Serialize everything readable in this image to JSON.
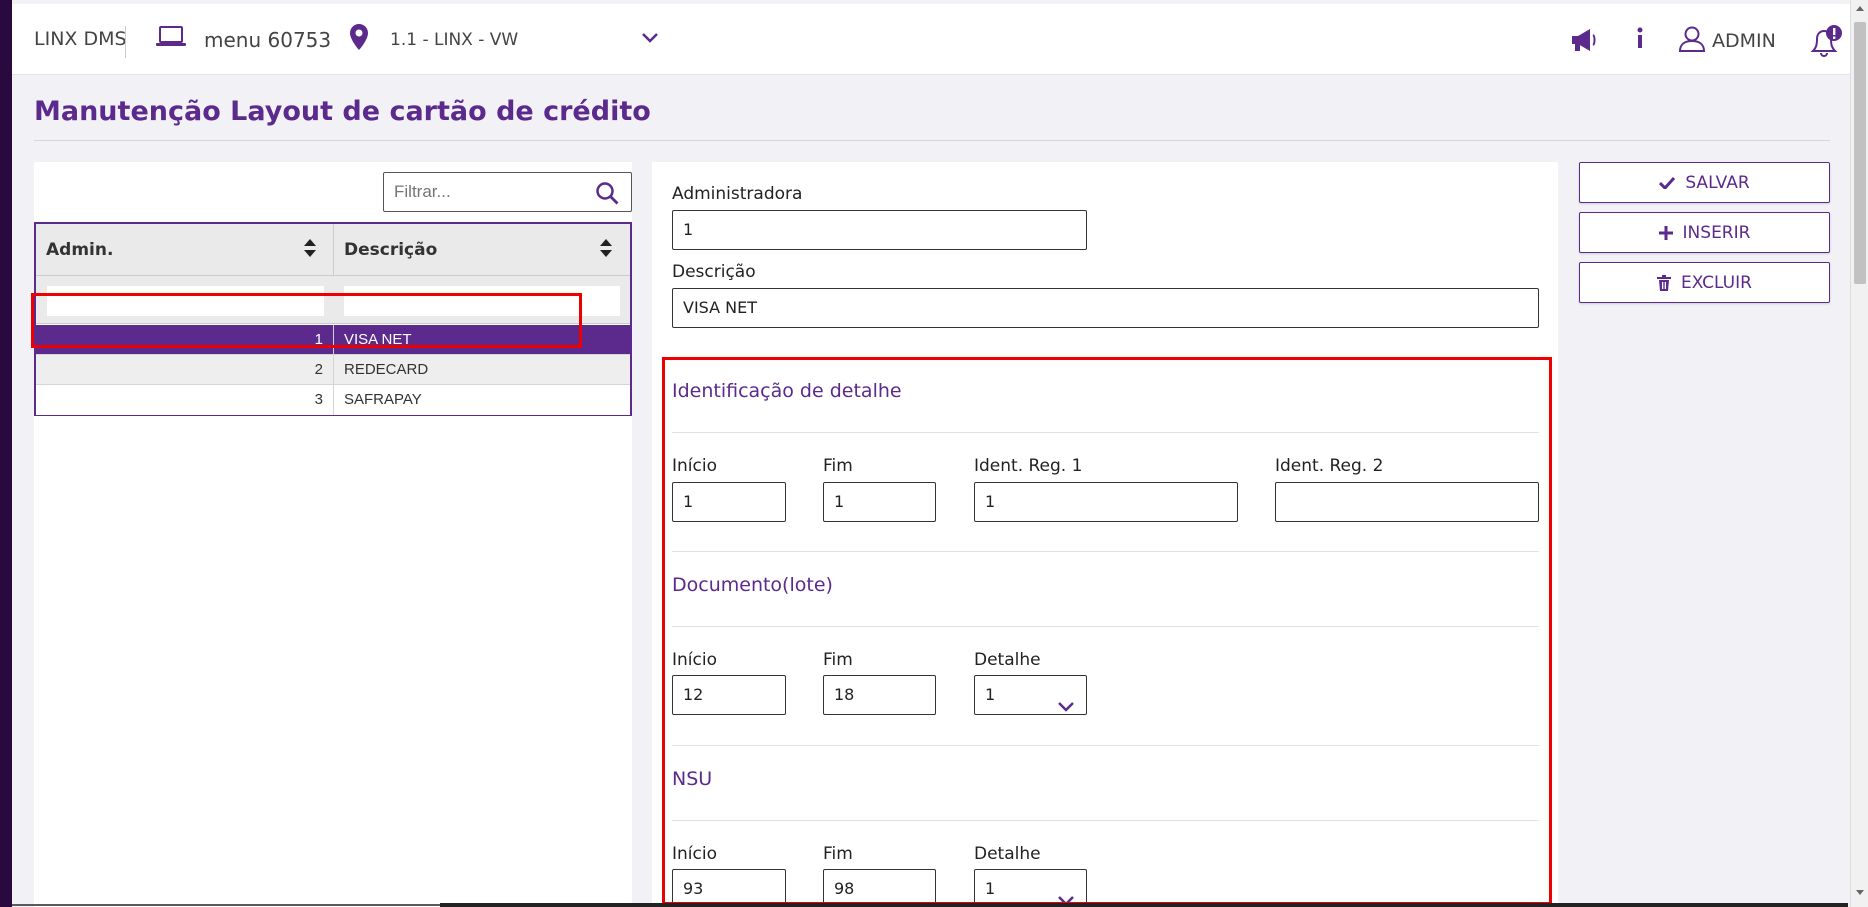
{
  "topbar": {
    "brand": "LINX DMS",
    "menu_label": "menu 60753",
    "location": "1.1 - LINX - VW",
    "user": "ADMIN",
    "icons": {
      "menu": "laptop-icon",
      "location": "map-pin-icon",
      "announce": "megaphone-icon",
      "info": "info-icon",
      "user": "user-icon",
      "notify": "bell-icon"
    }
  },
  "page": {
    "title": "Manutenção Layout de cartão de crédito"
  },
  "filter": {
    "placeholder": "Filtrar..."
  },
  "grid": {
    "columns": [
      "Admin.",
      "Descrição"
    ],
    "rows": [
      {
        "admin": "1",
        "descricao": "VISA NET",
        "selected": true
      },
      {
        "admin": "2",
        "descricao": "REDECARD",
        "selected": false
      },
      {
        "admin": "3",
        "descricao": "SAFRAPAY",
        "selected": false
      }
    ]
  },
  "form": {
    "administradora_label": "Administradora",
    "administradora_value": "1",
    "descricao_label": "Descrição",
    "descricao_value": "VISA NET",
    "sections": {
      "detalhe": {
        "title": "Identificação de detalhe",
        "inicio_label": "Início",
        "inicio_value": "1",
        "fim_label": "Fim",
        "fim_value": "1",
        "ident1_label": "Ident. Reg. 1",
        "ident1_value": "1",
        "ident2_label": "Ident. Reg. 2",
        "ident2_value": ""
      },
      "documento": {
        "title": "Documento(lote)",
        "inicio_label": "Início",
        "inicio_value": "12",
        "fim_label": "Fim",
        "fim_value": "18",
        "detalhe_label": "Detalhe",
        "detalhe_value": "1"
      },
      "nsu": {
        "title": "NSU",
        "inicio_label": "Início",
        "inicio_value": "93",
        "fim_label": "Fim",
        "fim_value": "98",
        "detalhe_label": "Detalhe",
        "detalhe_value": "1"
      }
    }
  },
  "actions": {
    "save": "SALVAR",
    "insert": "INSERIR",
    "delete": "EXCLUIR"
  },
  "colors": {
    "accent": "#5b2a8c",
    "highlight": "#e00000"
  }
}
